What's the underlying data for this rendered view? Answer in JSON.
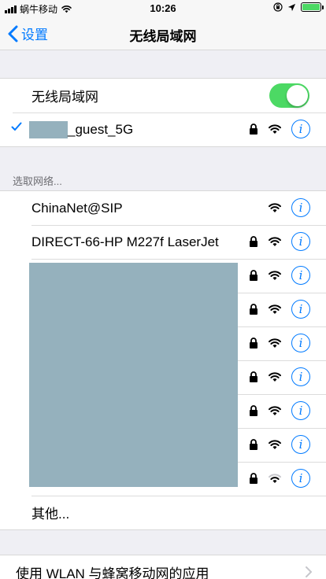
{
  "status_bar": {
    "carrier": "蜗牛移动",
    "time": "10:26"
  },
  "nav": {
    "back_label": "设置",
    "title": "无线局域网"
  },
  "wlan": {
    "toggle_label": "无线局域网",
    "toggle_on": true,
    "connected_suffix": "_guest_5G"
  },
  "section": {
    "header": "选取网络..."
  },
  "networks": [
    {
      "name": "ChinaNet@SIP",
      "locked": false
    },
    {
      "name": "DIRECT-66-HP M227f LaserJet",
      "locked": true
    },
    {
      "name": "",
      "locked": true
    },
    {
      "name": "",
      "locked": true
    },
    {
      "name": "",
      "locked": true
    },
    {
      "name": "",
      "locked": true
    },
    {
      "name": "",
      "locked": true
    },
    {
      "name": "",
      "locked": true
    },
    {
      "name": "",
      "locked": true
    }
  ],
  "other_label": "其他...",
  "footer_label": "使用 WLAN 与蜂窝移动网的应用",
  "colors": {
    "accent": "#007aff",
    "toggle_on": "#4cd964",
    "mask": "#95b1bd"
  }
}
